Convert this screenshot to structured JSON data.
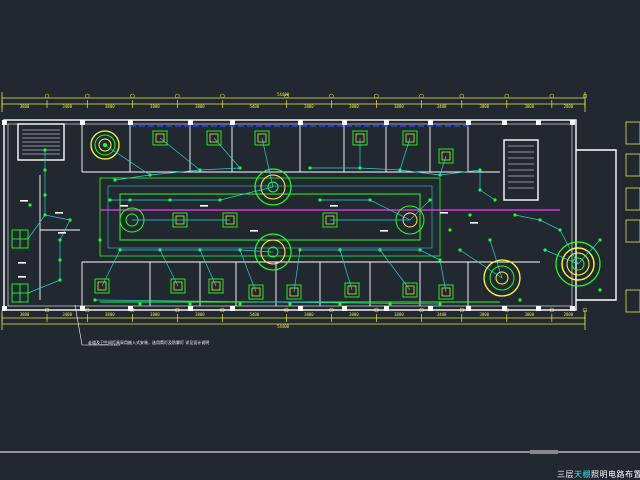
{
  "drawing": {
    "title_prefix": "三层",
    "title_highlight": "天棚",
    "title_suffix": "照明电路布置图",
    "overall_dimension": "54400",
    "bay_dimensions": [
      "3800",
      "3400",
      "3800",
      "3800",
      "3800",
      "5400",
      "3800",
      "3800",
      "3800",
      "3400",
      "3800",
      "3800",
      "2800"
    ],
    "note": "走道及卫生间灯具采用嵌入式安装，选用筒灯及防雾灯 详见设计说明"
  },
  "colors": {
    "background": "#212830",
    "wall": "#ffffff",
    "fixture": "#22ff22",
    "wiring": "#28d0d0",
    "dimension": "#e8e84a",
    "feature_ring": "#ffff33",
    "magenta_line": "#ff33ff",
    "blue_line": "#3040ff"
  }
}
